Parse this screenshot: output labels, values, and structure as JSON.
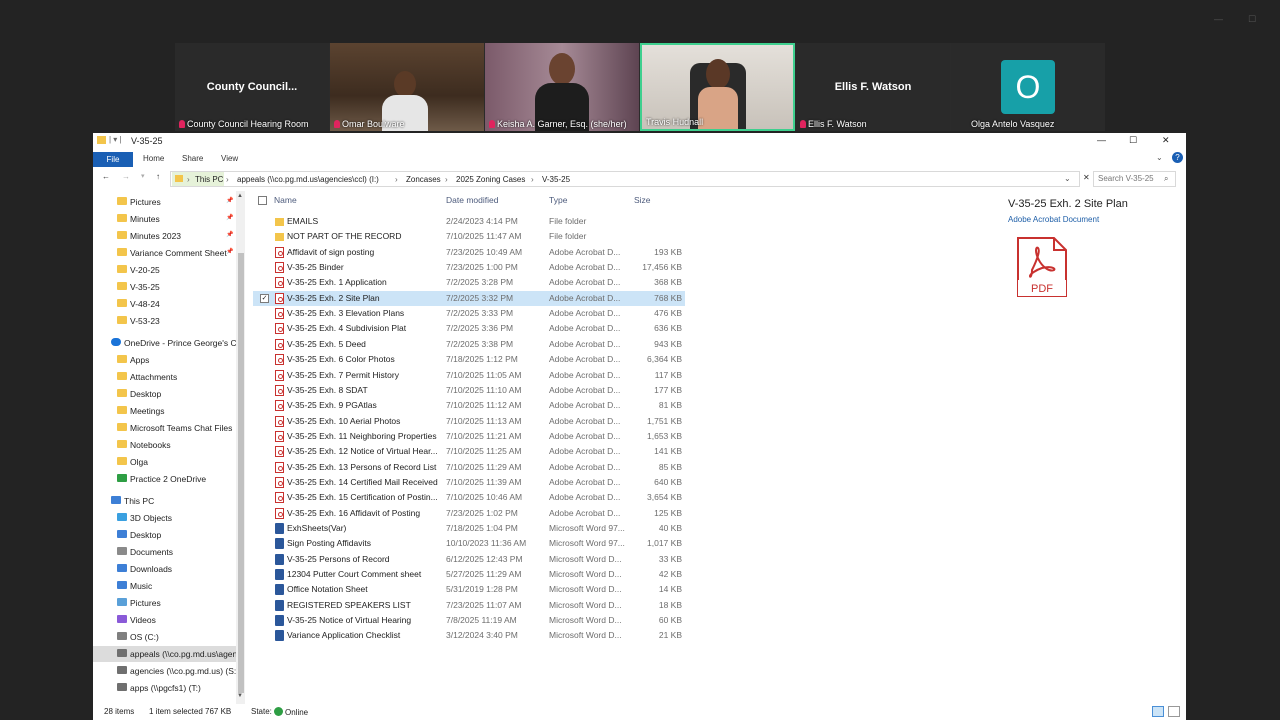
{
  "meeting": {
    "tiles": [
      {
        "caption": "County Council Hearing Room",
        "center_name": "County Council...",
        "muted": true
      },
      {
        "caption": "Omar Boulware",
        "muted": true
      },
      {
        "caption": "Keisha A. Garner, Esq. (she/her)",
        "muted": true
      },
      {
        "caption": "Travis Hudnall",
        "muted": false,
        "active_speaker": true
      },
      {
        "caption": "Ellis F. Watson",
        "center_name": "Ellis F. Watson",
        "muted": true
      },
      {
        "caption": "Olga Antelo Vasquez",
        "avatar_letter": "O",
        "muted": false
      }
    ]
  },
  "window": {
    "title": "V-35-25",
    "controls": {
      "minimize": "—",
      "maximize": "☐",
      "close": "✕"
    }
  },
  "ribbon": {
    "file": "File",
    "tabs": [
      "Home",
      "Share",
      "View"
    ],
    "help": "?"
  },
  "address": {
    "breadcrumbs": [
      "This PC",
      "appeals (\\\\co.pg.md.us\\agencies\\ccl) (I:)",
      "Zoncases",
      "2025 Zoning Cases",
      "V-35-25"
    ],
    "search_placeholder": "Search V-35-25"
  },
  "sidebar": {
    "quick_access": [
      {
        "label": "Pictures",
        "pinned": true
      },
      {
        "label": "Minutes",
        "pinned": true
      },
      {
        "label": "Minutes 2023",
        "pinned": true
      },
      {
        "label": "Variance Comment Sheet",
        "pinned": true
      },
      {
        "label": "V-20-25",
        "pinned": false
      },
      {
        "label": "V-35-25",
        "pinned": false
      },
      {
        "label": "V-48-24",
        "pinned": false
      },
      {
        "label": "V-53-23",
        "pinned": false
      }
    ],
    "onedrive": {
      "label": "OneDrive - Prince George's County",
      "items": [
        "Apps",
        "Attachments",
        "Desktop",
        "Meetings",
        "Microsoft Teams Chat Files",
        "Notebooks",
        "Olga",
        "Practice 2 OneDrive"
      ]
    },
    "this_pc": {
      "label": "This PC",
      "items": [
        "3D Objects",
        "Desktop",
        "Documents",
        "Downloads",
        "Music",
        "Pictures",
        "Videos",
        "OS (C:)",
        "appeals (\\\\co.pg.md.us\\agencies)",
        "agencies (\\\\co.pg.md.us) (S:)",
        "apps (\\\\pgcfs1) (T:)"
      ]
    }
  },
  "filelist": {
    "columns": {
      "name": "Name",
      "date": "Date modified",
      "type": "Type",
      "size": "Size"
    },
    "files": [
      {
        "name": "EMAILS",
        "date": "2/24/2023 4:14 PM",
        "type": "File folder",
        "size": "",
        "icon": "folder"
      },
      {
        "name": "NOT PART OF THE RECORD",
        "date": "7/10/2025 11:47 AM",
        "type": "File folder",
        "size": "",
        "icon": "folder"
      },
      {
        "name": "Affidavit of sign posting",
        "date": "7/23/2025 10:49 AM",
        "type": "Adobe Acrobat D...",
        "size": "193 KB",
        "icon": "pdf"
      },
      {
        "name": "V-35-25 Binder",
        "date": "7/23/2025 1:00 PM",
        "type": "Adobe Acrobat D...",
        "size": "17,456 KB",
        "icon": "pdf"
      },
      {
        "name": "V-35-25 Exh. 1 Application",
        "date": "7/2/2025 3:28 PM",
        "type": "Adobe Acrobat D...",
        "size": "368 KB",
        "icon": "pdf"
      },
      {
        "name": "V-35-25 Exh. 2 Site Plan",
        "date": "7/2/2025 3:32 PM",
        "type": "Adobe Acrobat D...",
        "size": "768 KB",
        "icon": "pdf",
        "selected": true
      },
      {
        "name": "V-35-25 Exh. 3 Elevation Plans",
        "date": "7/2/2025 3:33 PM",
        "type": "Adobe Acrobat D...",
        "size": "476 KB",
        "icon": "pdf"
      },
      {
        "name": "V-35-25 Exh. 4 Subdivision Plat",
        "date": "7/2/2025 3:36 PM",
        "type": "Adobe Acrobat D...",
        "size": "636 KB",
        "icon": "pdf"
      },
      {
        "name": "V-35-25 Exh. 5 Deed",
        "date": "7/2/2025 3:38 PM",
        "type": "Adobe Acrobat D...",
        "size": "943 KB",
        "icon": "pdf"
      },
      {
        "name": "V-35-25 Exh. 6 Color Photos",
        "date": "7/18/2025 1:12 PM",
        "type": "Adobe Acrobat D...",
        "size": "6,364 KB",
        "icon": "pdf"
      },
      {
        "name": "V-35-25 Exh. 7 Permit History",
        "date": "7/10/2025 11:05 AM",
        "type": "Adobe Acrobat D...",
        "size": "117 KB",
        "icon": "pdf"
      },
      {
        "name": "V-35-25 Exh. 8 SDAT",
        "date": "7/10/2025 11:10 AM",
        "type": "Adobe Acrobat D...",
        "size": "177 KB",
        "icon": "pdf"
      },
      {
        "name": "V-35-25 Exh. 9 PGAtlas",
        "date": "7/10/2025 11:12 AM",
        "type": "Adobe Acrobat D...",
        "size": "81 KB",
        "icon": "pdf"
      },
      {
        "name": "V-35-25 Exh. 10 Aerial Photos",
        "date": "7/10/2025 11:13 AM",
        "type": "Adobe Acrobat D...",
        "size": "1,751 KB",
        "icon": "pdf"
      },
      {
        "name": "V-35-25 Exh. 11 Neighboring Properties",
        "date": "7/10/2025 11:21 AM",
        "type": "Adobe Acrobat D...",
        "size": "1,653 KB",
        "icon": "pdf"
      },
      {
        "name": "V-35-25 Exh. 12 Notice of Virtual Hear...",
        "date": "7/10/2025 11:25 AM",
        "type": "Adobe Acrobat D...",
        "size": "141 KB",
        "icon": "pdf"
      },
      {
        "name": "V-35-25 Exh. 13 Persons of Record List",
        "date": "7/10/2025 11:29 AM",
        "type": "Adobe Acrobat D...",
        "size": "85 KB",
        "icon": "pdf"
      },
      {
        "name": "V-35-25 Exh. 14 Certified Mail Received",
        "date": "7/10/2025 11:39 AM",
        "type": "Adobe Acrobat D...",
        "size": "640 KB",
        "icon": "pdf"
      },
      {
        "name": "V-35-25 Exh. 15 Certification of Postin...",
        "date": "7/10/2025 10:46 AM",
        "type": "Adobe Acrobat D...",
        "size": "3,654 KB",
        "icon": "pdf"
      },
      {
        "name": "V-35-25 Exh. 16 Affidavit of Posting",
        "date": "7/23/2025 1:02 PM",
        "type": "Adobe Acrobat D...",
        "size": "125 KB",
        "icon": "pdf"
      },
      {
        "name": "ExhSheets(Var)",
        "date": "7/18/2025 1:04 PM",
        "type": "Microsoft Word 97...",
        "size": "40 KB",
        "icon": "word"
      },
      {
        "name": "Sign Posting Affidavits",
        "date": "10/10/2023 11:36 AM",
        "type": "Microsoft Word 97...",
        "size": "1,017 KB",
        "icon": "word"
      },
      {
        "name": "V-35-25 Persons of Record",
        "date": "6/12/2025 12:43 PM",
        "type": "Microsoft Word D...",
        "size": "33 KB",
        "icon": "word"
      },
      {
        "name": "12304 Putter Court Comment sheet",
        "date": "5/27/2025 11:29 AM",
        "type": "Microsoft Word D...",
        "size": "42 KB",
        "icon": "word"
      },
      {
        "name": "Office Notation Sheet",
        "date": "5/31/2019 1:28 PM",
        "type": "Microsoft Word D...",
        "size": "14 KB",
        "icon": "word"
      },
      {
        "name": "REGISTERED SPEAKERS LIST",
        "date": "7/23/2025 11:07 AM",
        "type": "Microsoft Word D...",
        "size": "18 KB",
        "icon": "word"
      },
      {
        "name": "V-35-25 Notice of Virtual Hearing",
        "date": "7/8/2025 11:19 AM",
        "type": "Microsoft Word D...",
        "size": "60 KB",
        "icon": "word"
      },
      {
        "name": "Variance Application Checklist",
        "date": "3/12/2024 3:40 PM",
        "type": "Microsoft Word D...",
        "size": "21 KB",
        "icon": "word"
      }
    ]
  },
  "preview": {
    "title": "V-35-25 Exh. 2 Site Plan",
    "subtitle": "Adobe Acrobat Document",
    "icon_label": "PDF"
  },
  "status": {
    "item_count": "28 items",
    "selected": "1 item selected  767 KB",
    "state_label": "State:",
    "state_value": "Online"
  },
  "colors": {
    "accent": "#1a5fb4",
    "selection": "#cce4f7",
    "pdf_red": "#c8312f",
    "word_blue": "#2b579a",
    "folder_yellow": "#f3c54b",
    "active_speaker_border": "#3ecf8e",
    "avatar_teal": "#17a0a8"
  }
}
